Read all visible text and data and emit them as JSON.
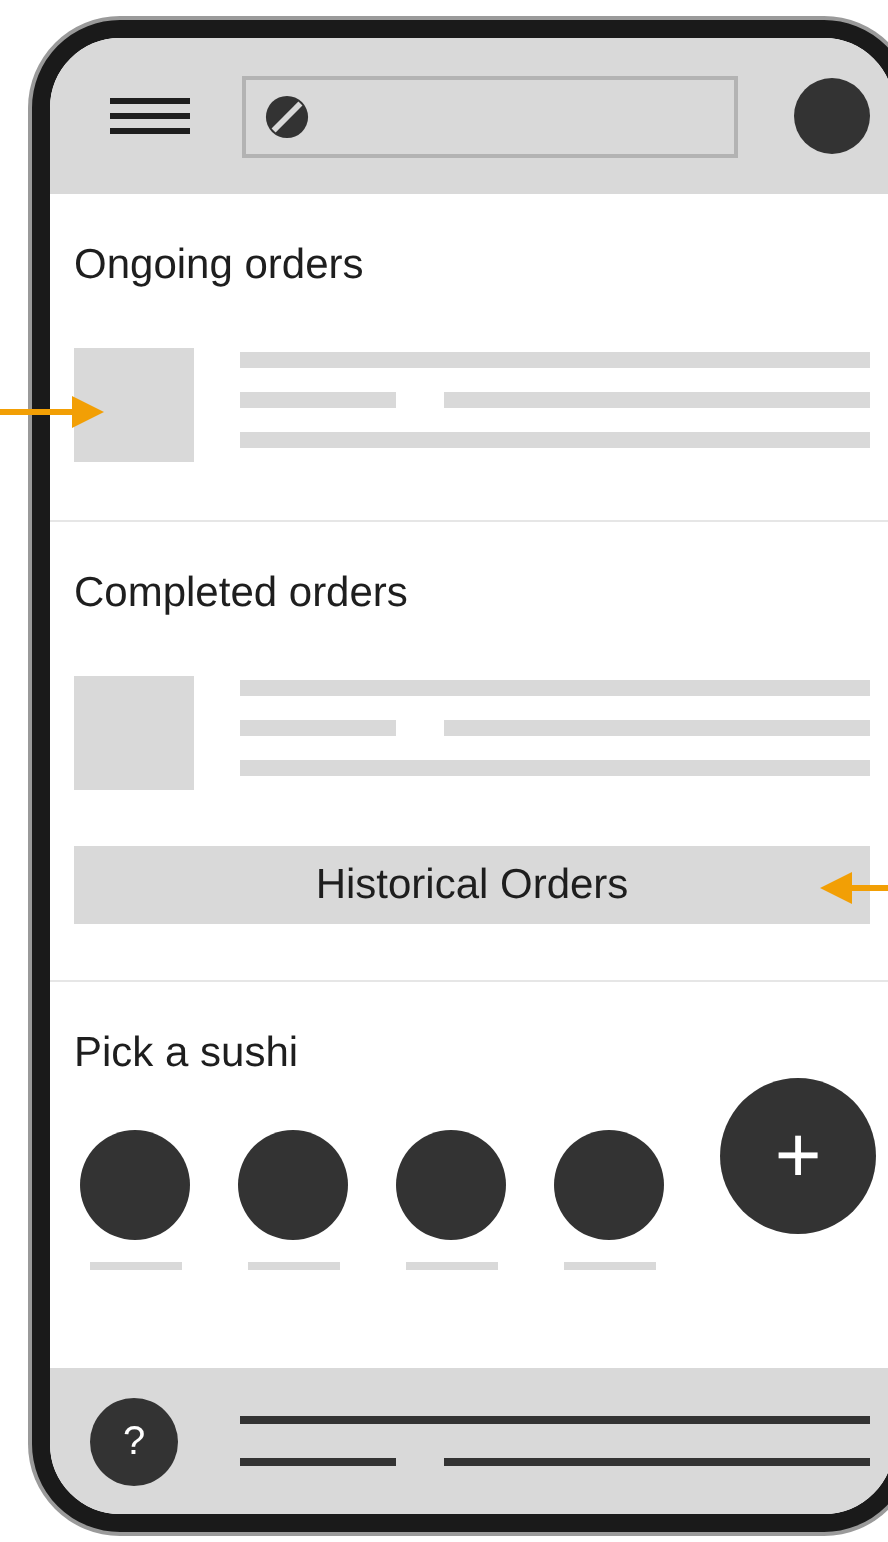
{
  "sections": [
    {
      "kind": "orders",
      "title": "Ongoing orders"
    },
    {
      "kind": "orders",
      "title": "Completed orders",
      "button": "Historical Orders"
    },
    {
      "kind": "picker",
      "title": "Pick a sushi",
      "add_button": "+"
    }
  ],
  "bottom_bar": {
    "help_button": "?"
  }
}
